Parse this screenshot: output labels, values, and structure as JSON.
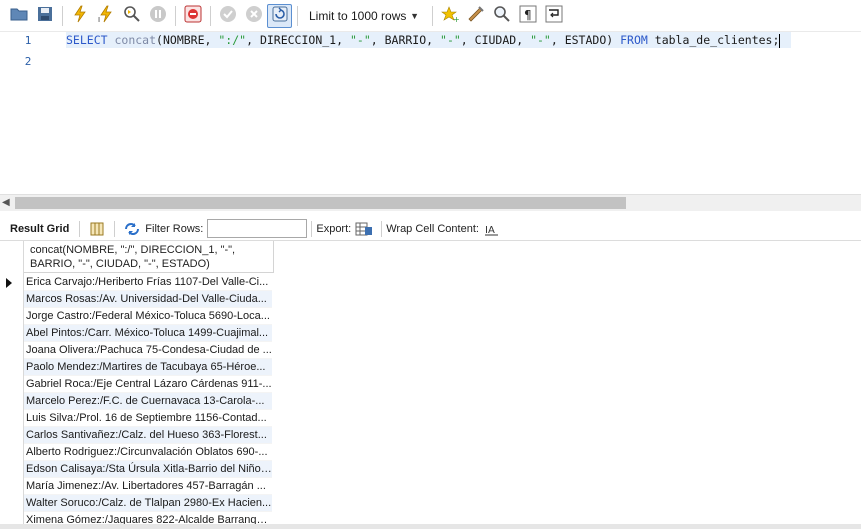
{
  "toolbar": {
    "limit_label": "Limit to 1000 rows"
  },
  "editor": {
    "lines": [
      {
        "number": "1"
      },
      {
        "number": "2"
      }
    ],
    "query_tokens": {
      "kw_select": "SELECT",
      "fn_concat": "concat",
      "p_open": "(",
      "id_nombre": "NOMBRE",
      "comma": ", ",
      "str_sep1": "\":/\"",
      "id_direccion": "DIRECCION_1",
      "str_dash": "\"-\"",
      "id_barrio": "BARRIO",
      "id_ciudad": "CIUDAD",
      "id_estado": "ESTADO",
      "p_close": ")",
      "kw_from": "FROM",
      "id_table": "tabla_de_clientes;"
    }
  },
  "result_toolbar": {
    "tab_label": "Result Grid",
    "filter_label": "Filter Rows:",
    "filter_value": "",
    "export_label": "Export:",
    "wrap_label": "Wrap Cell Content:"
  },
  "grid": {
    "column_header": "concat(NOMBRE, \":/\", DIRECCION_1, \"-\", BARRIO, \"-\", CIUDAD, \"-\", ESTADO)",
    "rows": [
      "Erica Carvajo:/Heriberto Frías 1107-Del Valle-Ci...",
      "Marcos Rosas:/Av. Universidad-Del Valle-Ciuda...",
      "Jorge Castro:/Federal México-Toluca 5690-Loca...",
      "Abel Pintos:/Carr. México-Toluca 1499-Cuajimal...",
      "Joana Olivera:/Pachuca 75-Condesa-Ciudad de ...",
      "Paolo Mendez:/Martires de Tacubaya 65-Héroe...",
      "Gabriel Roca:/Eje Central Lázaro Cárdenas 911-...",
      "Marcelo Perez:/F.C. de Cuernavaca 13-Carola-...",
      "Luis Silva:/Prol. 16 de Septiembre 1156-Contad...",
      "Carlos Santivañez:/Calz. del Hueso 363-Florest...",
      "Alberto Rodriguez:/Circunvalación Oblatos 690-...",
      "Edson Calisaya:/Sta Úrsula Xitla-Barrio del Niño ...",
      "María Jimenez:/Av. Libertadores 457-Barragán ...",
      "Walter Soruco:/Calz. de Tlalpan 2980-Ex Hacien...",
      "Ximena Gómez:/Jaguares 822-Alcalde Barranqui..."
    ]
  },
  "colors": {
    "keyword": "#2c58c9",
    "string": "#2a9a3a",
    "function": "#7f8aa6",
    "line_number": "#2a5ea8",
    "current_line": "#e6f0fb",
    "alt_row": "#edf3fb"
  },
  "icons": [
    "open-folder-icon",
    "save-icon",
    "execute-icon",
    "execute-current-icon",
    "explain-icon",
    "stop-icon",
    "toggle-error-icon",
    "commit-icon",
    "rollback-icon",
    "autocommit-icon",
    "dropdown-caret-icon",
    "bookmark-icon",
    "beautify-icon",
    "find-icon",
    "invisible-chars-icon",
    "wrap-lines-icon",
    "grid-layout-icon",
    "refresh-icon",
    "export-icon",
    "wrap-cell-icon",
    "row-pointer-icon"
  ]
}
